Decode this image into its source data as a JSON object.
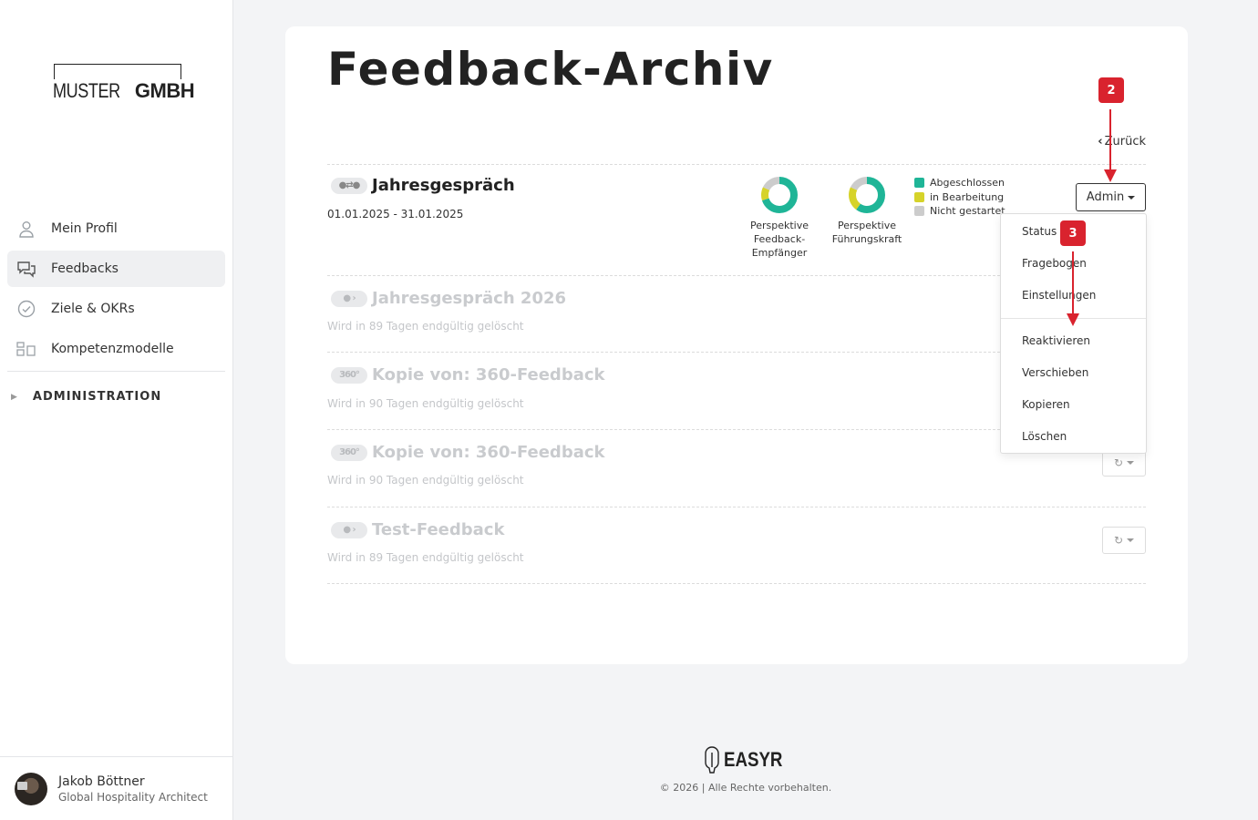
{
  "brand": {
    "logo_light": "MUSTER",
    "logo_bold": "GMBH"
  },
  "sidebar": {
    "items": [
      {
        "label": "Mein Profil",
        "icon": "user-icon"
      },
      {
        "label": "Feedbacks",
        "icon": "chat-bubbles-icon",
        "active": true
      },
      {
        "label": "Ziele & OKRs",
        "icon": "check-circle-icon"
      },
      {
        "label": "Kompetenzmodelle",
        "icon": "competence-model-icon"
      }
    ],
    "admin_section": "ADMINISTRATION",
    "user": {
      "name": "Jakob Böttner",
      "role": "Global Hospitality Architect"
    }
  },
  "main": {
    "title": "Feedback-Archiv",
    "back_label": "Zurück",
    "active_row": {
      "title": "Jahresgespräch",
      "dates": "01.01.2025 - 31.01.2025",
      "charts": [
        {
          "label_lines": [
            "Perspektive",
            "Feedback-",
            "Empfänger"
          ],
          "completed": 0.7,
          "in_progress": 0.12,
          "not_started": 0.18
        },
        {
          "label_lines": [
            "Perspektive",
            "Führungskraft"
          ],
          "completed": 0.6,
          "in_progress": 0.22,
          "not_started": 0.18
        }
      ],
      "legend": [
        "Abgeschlossen",
        "in Bearbeitung",
        "Nicht gestartet"
      ],
      "admin_label": "Admin"
    },
    "archived_rows": [
      {
        "title": "Jahresgespräch 2026",
        "note": "Wird in 89 Tagen endgültig gelöscht"
      },
      {
        "title": "Kopie von: 360-Feedback",
        "note": "Wird in 90 Tagen endgültig gelöscht"
      },
      {
        "title": "Kopie von: 360-Feedback",
        "note": "Wird in 90 Tagen endgültig gelöscht"
      },
      {
        "title": "Test-Feedback",
        "note": "Wird in 89 Tagen endgültig gelöscht"
      }
    ]
  },
  "dropdown": {
    "items": [
      "Status",
      "Fragebogen",
      "Einstellungen",
      "Reaktivieren",
      "Verschieben",
      "Kopieren",
      "Löschen"
    ]
  },
  "annotations": {
    "badge_2": "2",
    "badge_3": "3"
  },
  "footer": {
    "brand": "EASYR",
    "copyright": "© 2026 | Alle Rechte vorbehalten."
  },
  "colors": {
    "completed": "#1fb597",
    "in_progress": "#d6d32a",
    "not_started": "#cccccc",
    "annotation": "#d9232e"
  }
}
